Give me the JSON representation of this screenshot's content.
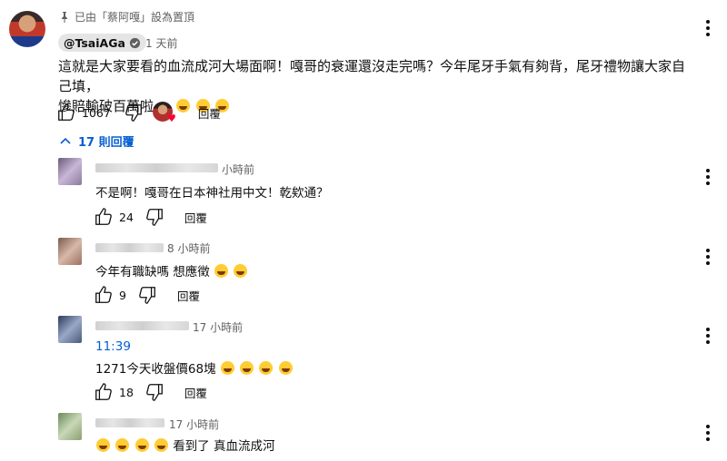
{
  "pinned": {
    "text": "已由「蔡阿嘎」設為置頂"
  },
  "main_comment": {
    "author": "@TsaiAGa",
    "time": "1 天前",
    "text_line1": "這就是大家要看的血流成河大場面啊！嘎哥的衰運還沒走完嗎？今年尾牙手氣有夠背，尾牙禮物讓大家自己填，",
    "text_line2": "慘賠輸破百萬啦....",
    "likes": "1067",
    "reply_label": "回覆"
  },
  "replies_toggle": {
    "label": "17 則回覆"
  },
  "replies": [
    {
      "time": "小時前",
      "text": "不是啊！嘎哥在日本神社用中文！乾欸通？",
      "likes": "24",
      "reply_label": "回覆"
    },
    {
      "time": "8 小時前",
      "text": "今年有職缺嗎 想應徵",
      "likes": "9",
      "reply_label": "回覆"
    },
    {
      "time": "17 小時前",
      "timestamp": "11:39",
      "text": "1271今天收盤價68塊",
      "likes": "18",
      "reply_label": "回覆"
    },
    {
      "time": "17 小時前",
      "text_prefix": "",
      "text": "看到了  真血流成河"
    }
  ],
  "colors": {
    "link": "#065fd4",
    "secondary": "#606060",
    "heart": "#ff0033"
  },
  "icons": [
    "pin-icon",
    "verified-check-icon",
    "thumbs-up-icon",
    "thumbs-down-icon",
    "more-vert-icon",
    "chevron-up-icon",
    "heart-icon",
    "laughing-emoji-icon",
    "grinning-emoji-icon",
    "crying-emoji-icon"
  ]
}
